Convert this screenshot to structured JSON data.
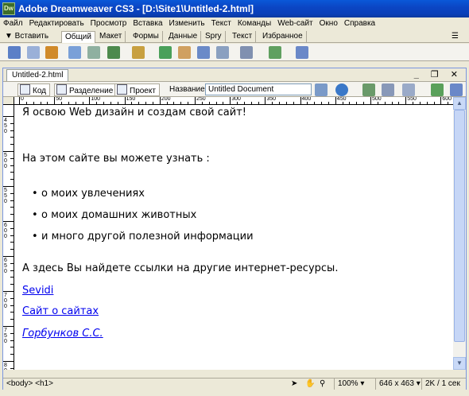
{
  "window": {
    "app_logo": "Dw",
    "title": "Adobe Dreamweaver CS3 - [D:\\Site1\\Untitled-2.html]"
  },
  "menu": [
    "Файл",
    "Редактировать",
    "Просмотр",
    "Вставка",
    "Изменить",
    "Текст",
    "Команды",
    "Web-сайт",
    "Окно",
    "Справка"
  ],
  "insert_bar": {
    "label": "▼ Вставить",
    "tabs": [
      "Общий",
      "Макет",
      "Формы",
      "Данные",
      "Spry",
      "Текст",
      "Избранное"
    ],
    "active_tab": "Общий"
  },
  "document": {
    "tab": "Untitled-2.html",
    "window_controls": "_ ❐ ✕",
    "views": {
      "code": "Код",
      "split": "Разделение",
      "design": "Проект"
    },
    "title_label": "Название:",
    "title_value": "Untitled Document"
  },
  "content": {
    "heading": "Я освою Web дизайн и создам свой сайт!",
    "intro": "На этом сайте вы можете узнать :",
    "list": [
      "о моих увлечениях",
      "о моих домашних животных",
      "и много другой полезной информации"
    ],
    "links_intro": "А здесь Вы найдете ссылки на другие интернет-ресурсы.",
    "links": [
      "Sevidi",
      "Сайт о сайтах",
      "Горбунков С.С."
    ]
  },
  "ruler": {
    "h_labels": [
      "0",
      "50",
      "100",
      "150",
      "200",
      "250",
      "300",
      "350",
      "400",
      "450",
      "500",
      "550",
      "600"
    ],
    "v_labels": [
      "450",
      "500",
      "550",
      "600",
      "650",
      "700",
      "750",
      "800"
    ]
  },
  "status": {
    "tags": "<body> <h1>",
    "zoom": "100%",
    "size": "646 x 463",
    "download": "2K / 1 сек"
  },
  "colors": {
    "titlebar": "#0a46c4",
    "link": "#0000ee"
  }
}
